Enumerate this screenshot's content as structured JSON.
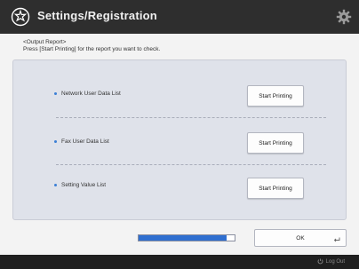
{
  "header": {
    "title": "Settings/Registration",
    "icon": "settings-registration-icon",
    "right_icon": "gear-icon"
  },
  "instructions": {
    "line1": "<Output Report>",
    "line2": "Press [Start Printing] for the report you want to check."
  },
  "reports": [
    {
      "label": "Network User Data List",
      "button": "Start Printing"
    },
    {
      "label": "Fax User Data List",
      "button": "Start Printing"
    },
    {
      "label": "Setting Value List",
      "button": "Start Printing"
    }
  ],
  "progress": {
    "fraction": 0.92
  },
  "ok_button": {
    "label": "OK"
  },
  "footer": {
    "logout_label": "Log Out"
  },
  "colors": {
    "titlebar": "#2e2e2e",
    "panel": "#dfe2ea",
    "accent": "#2f6fd0"
  }
}
